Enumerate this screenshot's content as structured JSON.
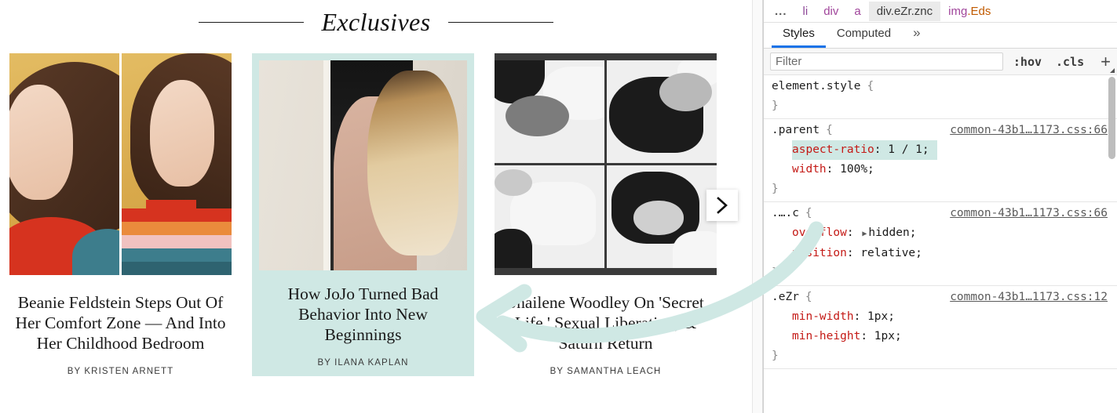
{
  "page": {
    "section": {
      "title": "Exclusives"
    },
    "carousel": {
      "next_label": "Next",
      "cards": [
        {
          "title": "Beanie Feldstein Steps Out Of Her Comfort Zone — And Into Her Childhood Bedroom",
          "byline": "BY KRISTEN ARNETT",
          "featured": false,
          "image_name": "beanie-feldstein-diptych"
        },
        {
          "title": "How JoJo Turned Bad Behavior Into New Beginnings",
          "byline": "BY ILANA KAPLAN",
          "featured": true,
          "image_name": "jojo-doorway-photo"
        },
        {
          "title": "Shailene Woodley On 'Secret Life,' Sexual Liberation, & Saturn Return",
          "byline": "BY SAMANTHA LEACH",
          "featured": false,
          "image_name": "shailene-woodley-quad-bw"
        }
      ]
    }
  },
  "devtools": {
    "breadcrumbs": [
      {
        "text": "...",
        "style": "dim"
      },
      {
        "text": "li",
        "style": "tag-li"
      },
      {
        "text": "div",
        "style": "tag"
      },
      {
        "text": "a",
        "style": "tag"
      },
      {
        "text": "div.eZr.znc",
        "style": "selected"
      },
      {
        "text": "img.Eds",
        "style": "tag-class",
        "tag": "img",
        "cls": ".Eds"
      }
    ],
    "tabs": [
      {
        "label": "Styles",
        "active": true
      },
      {
        "label": "Computed",
        "active": false
      },
      {
        "label": "»",
        "active": false
      }
    ],
    "filter": {
      "placeholder": "Filter",
      "value": "",
      "hov_label": ":hov",
      "cls_label": ".cls",
      "plus_label": "+"
    },
    "rules": [
      {
        "selector": "element.style",
        "origin": "",
        "declarations": []
      },
      {
        "selector": ".parent",
        "origin": "common-43b1…1173.css:66",
        "declarations": [
          {
            "prop": "aspect-ratio",
            "value": "1 / 1",
            "highlight": true
          },
          {
            "prop": "width",
            "value": "100%",
            "highlight": false
          }
        ]
      },
      {
        "selector": ".….c",
        "origin": "common-43b1…1173.css:66",
        "declarations": [
          {
            "prop": "overflow",
            "value": "hidden",
            "highlight": false,
            "expandable": true
          },
          {
            "prop": "position",
            "value": "relative",
            "highlight": false
          }
        ]
      },
      {
        "selector": ".eZr",
        "origin": "common-43b1…1173.css:12",
        "declarations": [
          {
            "prop": "min-width",
            "value": "1px",
            "highlight": false
          },
          {
            "prop": "min-height",
            "value": "1px",
            "highlight": false
          }
        ]
      }
    ]
  },
  "annotation": {
    "name": "curved-arrow-pointing-left",
    "color": "#cfe8e4"
  },
  "colors": {
    "highlight_mint": "#cfe8e4",
    "accent_blue": "#1a73e8",
    "prop_red": "#c41a16",
    "tag_magenta": "#a0459b",
    "class_orange": "#c05a00"
  }
}
